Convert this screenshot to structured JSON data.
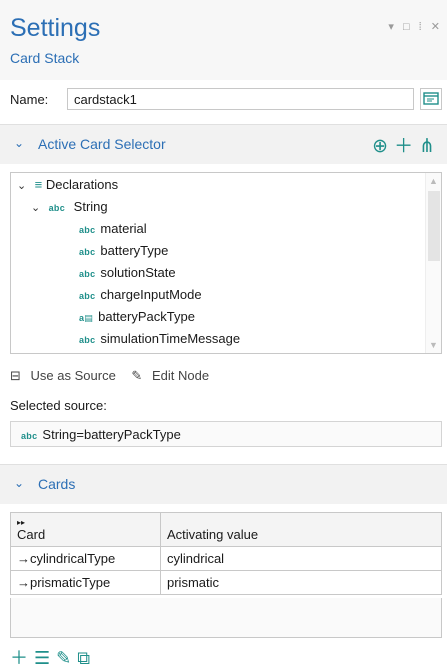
{
  "settings": {
    "title": "Settings",
    "subtitle": "Card Stack"
  },
  "window_controls": "▾ □ ⁞ ✕",
  "name_field": {
    "label": "Name:",
    "value": "cardstack1"
  },
  "active_card_selector": {
    "title": "Active Card Selector",
    "tree": {
      "root": "Declarations",
      "group": "String",
      "items": [
        {
          "label": "material",
          "badge": "abc"
        },
        {
          "label": "batteryType",
          "badge": "abc"
        },
        {
          "label": "solutionState",
          "badge": "abc"
        },
        {
          "label": "chargeInputMode",
          "badge": "abc"
        },
        {
          "label": "batteryPackType",
          "badge": "a▤"
        },
        {
          "label": "simulationTimeMessage",
          "badge": "abc"
        }
      ],
      "group_badge": "abc"
    },
    "actions": {
      "use_as_source": "Use as Source",
      "edit_node": "Edit Node"
    },
    "selected_source_label": "Selected source:",
    "selected_source_value": "String=batteryPackType"
  },
  "cards": {
    "title": "Cards",
    "columns": [
      "Card",
      "Activating value"
    ],
    "rows": [
      [
        "→cylindricalType",
        "cylindrical"
      ],
      [
        "→prismaticType",
        "prismatic"
      ]
    ]
  },
  "colors": {
    "accent": "#2c6fb5",
    "icon_teal": "#1f8f8a"
  }
}
